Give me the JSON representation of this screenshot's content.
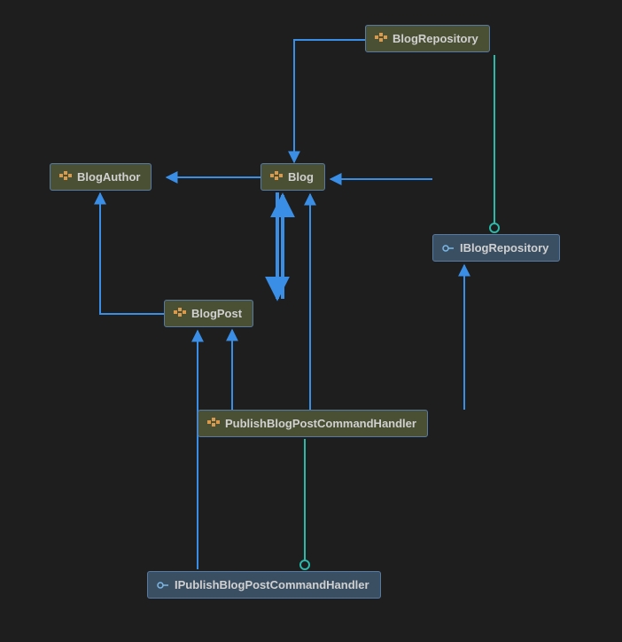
{
  "colors": {
    "background": "#1e1e1e",
    "class_fill": "#4a5034",
    "interface_fill": "#3b4f63",
    "node_border": "#577aa3",
    "dependency_line": "#3a8ee6",
    "implements_line": "#2bb9a9",
    "text": "#d0d0d0",
    "class_icon": "#d99a4e",
    "interface_icon": "#7bb8e8"
  },
  "nodes": {
    "blogRepository": {
      "label": "BlogRepository",
      "kind": "class"
    },
    "blogAuthor": {
      "label": "BlogAuthor",
      "kind": "class"
    },
    "blog": {
      "label": "Blog",
      "kind": "class"
    },
    "iBlogRepository": {
      "label": "IBlogRepository",
      "kind": "interface"
    },
    "blogPost": {
      "label": "BlogPost",
      "kind": "class"
    },
    "publishHandler": {
      "label": "PublishBlogPostCommandHandler",
      "kind": "class"
    },
    "iPublishHandler": {
      "label": "IPublishBlogPostCommandHandler",
      "kind": "interface"
    }
  },
  "edges": [
    {
      "from": "blogRepository",
      "to": "blog",
      "type": "dependency"
    },
    {
      "from": "blogRepository",
      "to": "iBlogRepository",
      "type": "implements"
    },
    {
      "from": "blog",
      "to": "blogAuthor",
      "type": "dependency"
    },
    {
      "from": "blog",
      "to": "blogPost",
      "type": "dependency"
    },
    {
      "from": "blogPost",
      "to": "blog",
      "type": "dependency"
    },
    {
      "from": "blogPost",
      "to": "blogAuthor",
      "type": "dependency"
    },
    {
      "from": "iBlogRepository",
      "to": "blog",
      "type": "dependency"
    },
    {
      "from": "publishHandler",
      "to": "blog",
      "type": "dependency"
    },
    {
      "from": "publishHandler",
      "to": "blogPost",
      "type": "dependency"
    },
    {
      "from": "publishHandler",
      "to": "iBlogRepository",
      "type": "dependency"
    },
    {
      "from": "publishHandler",
      "to": "iPublishHandler",
      "type": "implements"
    },
    {
      "from": "iPublishHandler",
      "to": "blogPost",
      "type": "dependency"
    }
  ]
}
